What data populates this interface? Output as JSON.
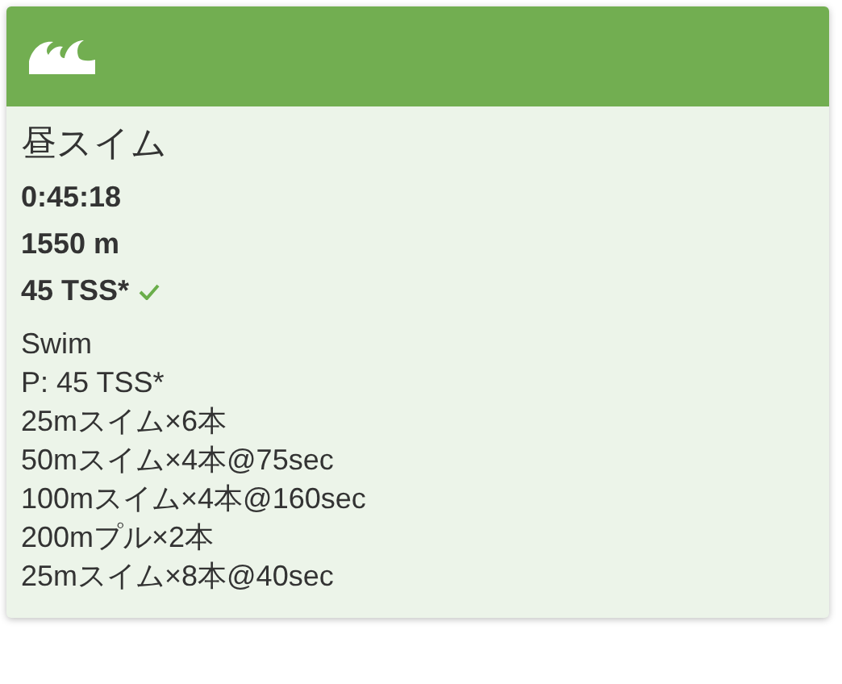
{
  "title": "昼スイム",
  "duration": "0:45:18",
  "distance": "1550 m",
  "tss": {
    "value": "45 TSS*",
    "completed": true
  },
  "description": [
    "Swim",
    "P: 45 TSS*",
    "25mスイム×6本",
    "50mスイム×4本@75sec",
    "100mスイム×4本@160sec",
    "200mプル×2本",
    "25mスイム×8本@40sec"
  ]
}
